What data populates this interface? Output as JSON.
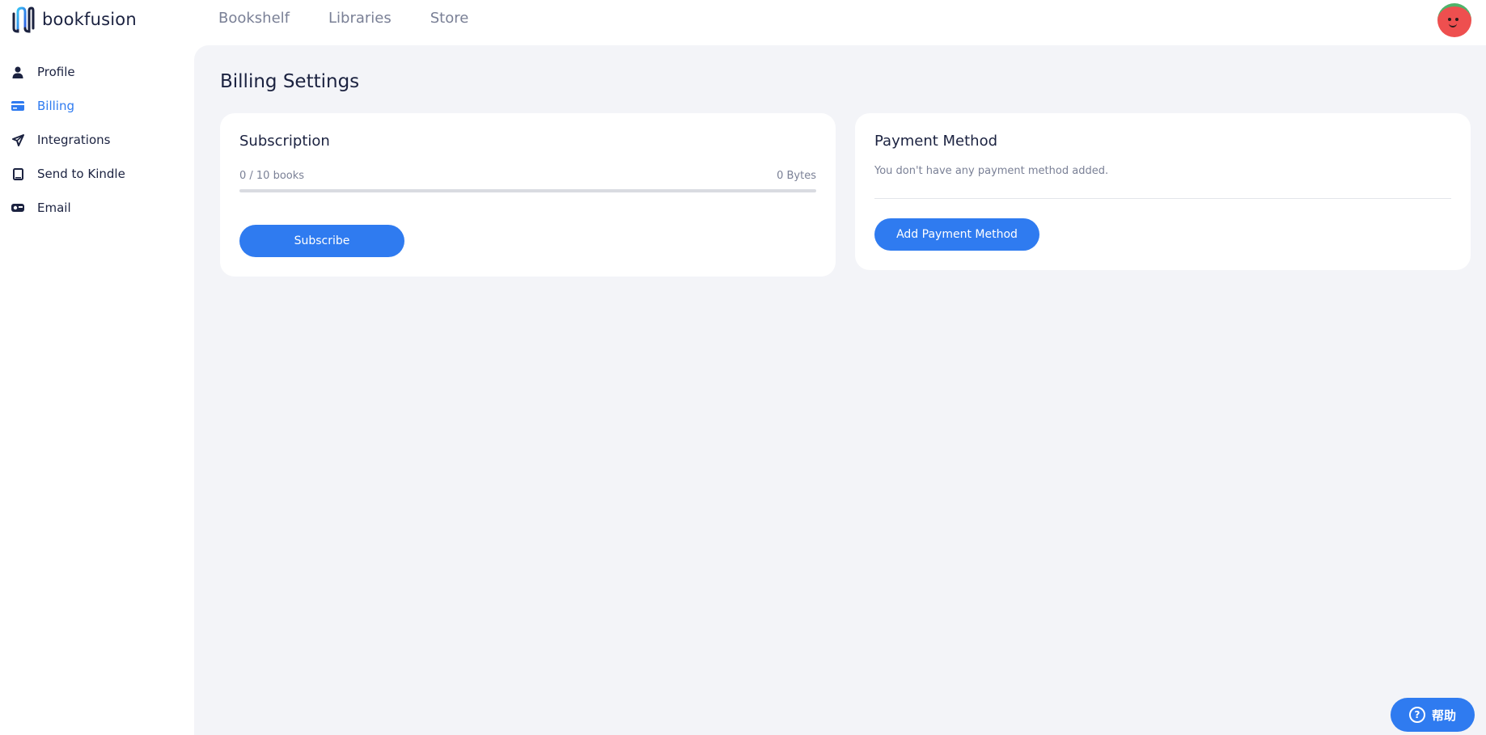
{
  "app": {
    "name": "bookfusion"
  },
  "topnav": {
    "items": [
      {
        "label": "Bookshelf"
      },
      {
        "label": "Libraries"
      },
      {
        "label": "Store"
      }
    ]
  },
  "sidebar": {
    "items": [
      {
        "label": "Profile",
        "icon": "user-icon",
        "active": false
      },
      {
        "label": "Billing",
        "icon": "credit-card-icon",
        "active": true
      },
      {
        "label": "Integrations",
        "icon": "send-icon",
        "active": false
      },
      {
        "label": "Send to Kindle",
        "icon": "tablet-icon",
        "active": false
      },
      {
        "label": "Email",
        "icon": "mailbox-icon",
        "active": false
      }
    ]
  },
  "page": {
    "title": "Billing Settings"
  },
  "subscription": {
    "title": "Subscription",
    "usage_books": "0 / 10 books",
    "usage_size": "0 Bytes",
    "usage_fraction": 0,
    "button_label": "Subscribe"
  },
  "payment": {
    "title": "Payment Method",
    "message": "You don't have any payment method added.",
    "button_label": "Add Payment Method"
  },
  "help": {
    "label": "帮助"
  },
  "colors": {
    "accent": "#2f7bf0",
    "background": "#f3f4f8",
    "text": "#1b2240",
    "muted": "#7a8096"
  }
}
